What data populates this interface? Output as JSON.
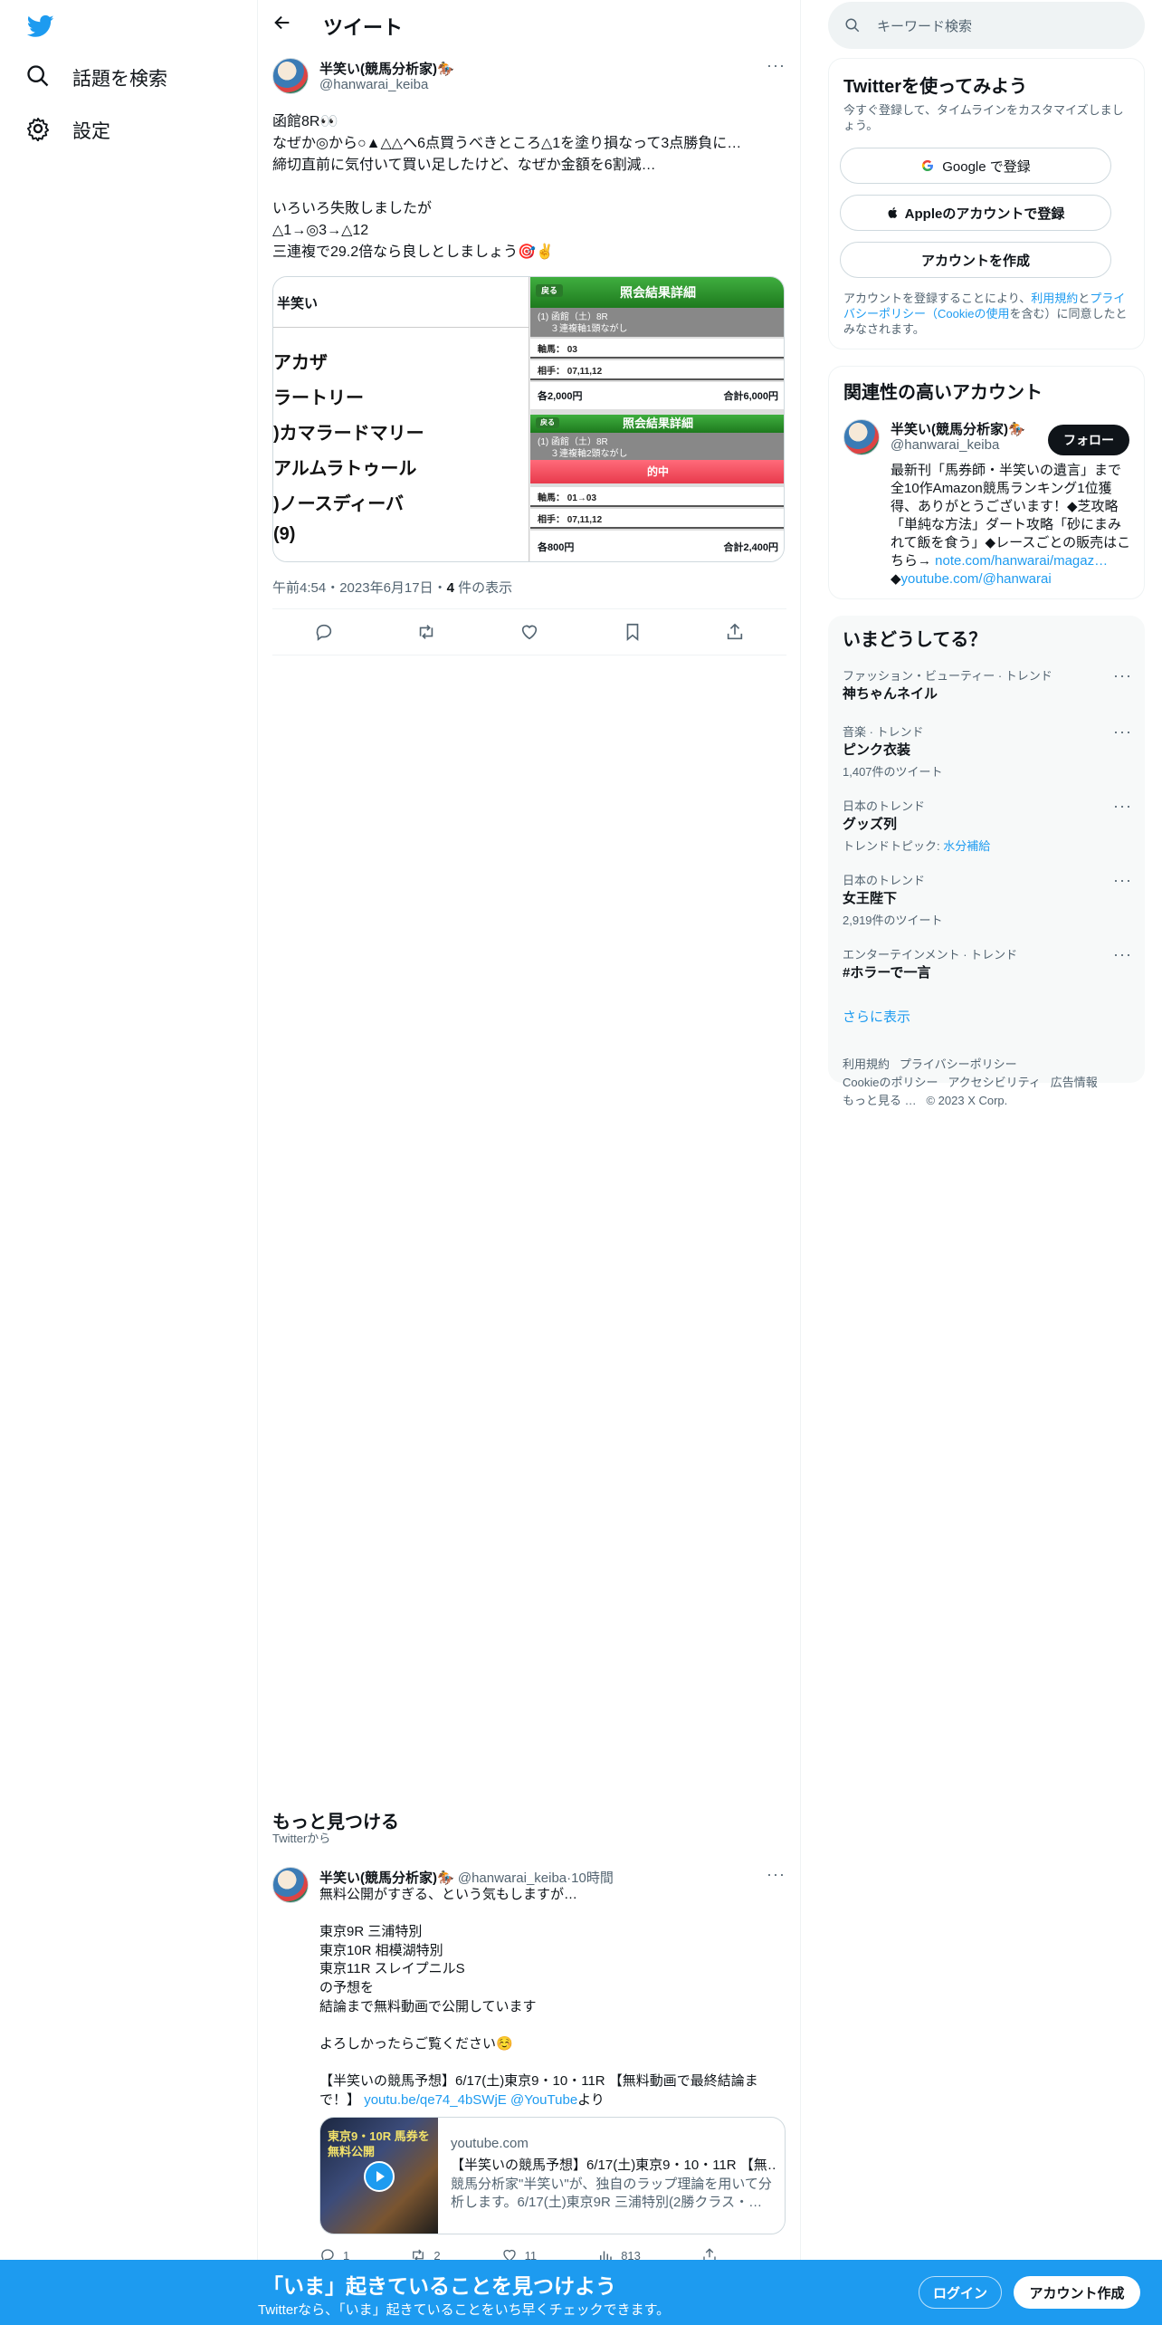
{
  "nav": {
    "items": [
      {
        "label": "話題を検索",
        "icon": "search-icon"
      },
      {
        "label": "設定",
        "icon": "gear-icon"
      }
    ]
  },
  "header": {
    "title": "ツイート"
  },
  "tweet": {
    "name": "半笑い(競馬分析家)🏇",
    "handle": "@hanwarai_keiba",
    "text": "函館8R👀\nなぜか◎から○▲△△へ6点買うべきところ△1を塗り損なって3点勝負に…\n締切直前に気付いて買い足したけど、なぜか金額を6割減…\n\nいろいろ失敗しましたが\n△1→◎3→△12\n三連複で29.2倍なら良しとしましょう🎯✌️",
    "image": {
      "left_header": "半笑い",
      "horses": [
        "アカザ",
        "ラートリー",
        ")カマラードマリー",
        "アルムラトゥール",
        ")ノースディーバ",
        "(9)"
      ],
      "ticket1": {
        "back": "戻る",
        "title": "照会結果詳細",
        "race": "(1) 函館（土）8R",
        "type": "３連複軸1頭ながし",
        "axis": "軸馬： 03",
        "partners": "相手： 07,11,12",
        "each": "各2,000円",
        "total": "合計6,000円"
      },
      "ticket2": {
        "back": "戻る",
        "title": "照会結果詳細",
        "race": "(1) 函館（土）8R",
        "type": "３連複軸2頭ながし",
        "hit": "的中",
        "axis": "軸馬： 01→03",
        "partners": "相手： 07,11,12",
        "each": "各800円",
        "total": "合計2,400円"
      }
    },
    "time": "午前4:54・2023年6月17日・",
    "views_count": "4",
    "views_label": " 件の表示"
  },
  "more": {
    "title": "もっと見つける",
    "subtitle": "Twitterから"
  },
  "tweet2": {
    "name": "半笑い(競馬分析家)🏇",
    "handle": "@hanwarai_keiba",
    "time": "·10時間",
    "text": "無料公開がすぎる、という気もしますが…\n\n東京9R 三浦特別\n東京10R 相模湖特別\n東京11R スレイプニルS\nの予想を\n結論まで無料動画で公開しています\n\nよろしかったらご覧ください☺️\n\n【半笑いの競馬予想】6/17(土)東京9・10・11R 【無料動画で最終結論ま\nで！】",
    "link_url": "youtu.be/qe74_4bSWjE",
    "link_via": "@YouTube",
    "link_suffix": "より",
    "card": {
      "domain": "youtube.com",
      "title": "【半笑いの競馬予想】6/17(土)東京9・10・11R 【無…",
      "desc": "競馬分析家\"半笑い\"が、独自のラップ理論を用いて分析します。6/17(土)東京9R 三浦特別(2勝クラス・…",
      "thumb_text": "東京9・10R 馬券を無料公開"
    },
    "stats": {
      "reply": "1",
      "retweet": "2",
      "like": "11",
      "views": "813"
    }
  },
  "sidebar": {
    "search_placeholder": "キーワード検索",
    "signup": {
      "title": "Twitterを使ってみよう",
      "desc": "今すぐ登録して、タイムラインをカスタマイズしましょう。",
      "google": "Google で登録",
      "apple": "Appleのアカウントで登録",
      "create": "アカウントを作成",
      "terms_pre": "アカウントを登録することにより、",
      "terms_link1": "利用規約",
      "terms_mid": "と",
      "terms_link2": "プライバシーポリシー（Cookieの使用",
      "terms_post": "を含む）に同意したとみなされます。"
    },
    "related": {
      "title": "関連性の高いアカウント",
      "name": "半笑い(競馬分析家)🏇",
      "handle": "@hanwarai_keiba",
      "follow": "フォロー",
      "bio": "最新刊「馬券師・半笑いの遺言」まで全10作Amazon競馬ランキング1位獲得、ありがとうございます！◆芝攻略「単純な方法」ダート攻略「砂にまみれて飯を食う」◆レースごとの販売はこちら→ ",
      "bio_link": "note.com/hanwarai/magaz…",
      "bio_line2_prefix": "◆",
      "bio_link2": "youtube.com/@hanwarai"
    },
    "trends": {
      "title": "いまどうしてる？",
      "items": [
        {
          "category": "ファッション・ビューティー · トレンド",
          "name": "神ちゃんネイル",
          "sub": "",
          "sublink": ""
        },
        {
          "category": "音楽 · トレンド",
          "name": "ピンク衣装",
          "sub": "1,407件のツイート",
          "sublink": ""
        },
        {
          "category": "日本のトレンド",
          "name": "グッズ列",
          "sub": "トレンドトピック: ",
          "sublink": "水分補給"
        },
        {
          "category": "日本のトレンド",
          "name": "女王陛下",
          "sub": "2,919件のツイート",
          "sublink": ""
        },
        {
          "category": "エンターテインメント · トレンド",
          "name": "#ホラーで一言",
          "sub": "",
          "sublink": ""
        }
      ],
      "more": "さらに表示"
    },
    "footer": {
      "row1": [
        "利用規約",
        "プライバシーポリシー"
      ],
      "row2": [
        "Cookieのポリシー",
        "アクセシビリティ",
        "広告情報"
      ],
      "row3": [
        "もっと見る …",
        "© 2023 X Corp."
      ]
    }
  },
  "bottom": {
    "headline": "「いま」起きていることを見つけよう",
    "sub": "Twitterなら、「いま」起きていることをいち早くチェックできます。",
    "login": "ログイン",
    "signup": "アカウント作成"
  },
  "colors": {
    "brand": "#1d9bf0",
    "text": "#0f1419",
    "secondary": "#536471"
  }
}
